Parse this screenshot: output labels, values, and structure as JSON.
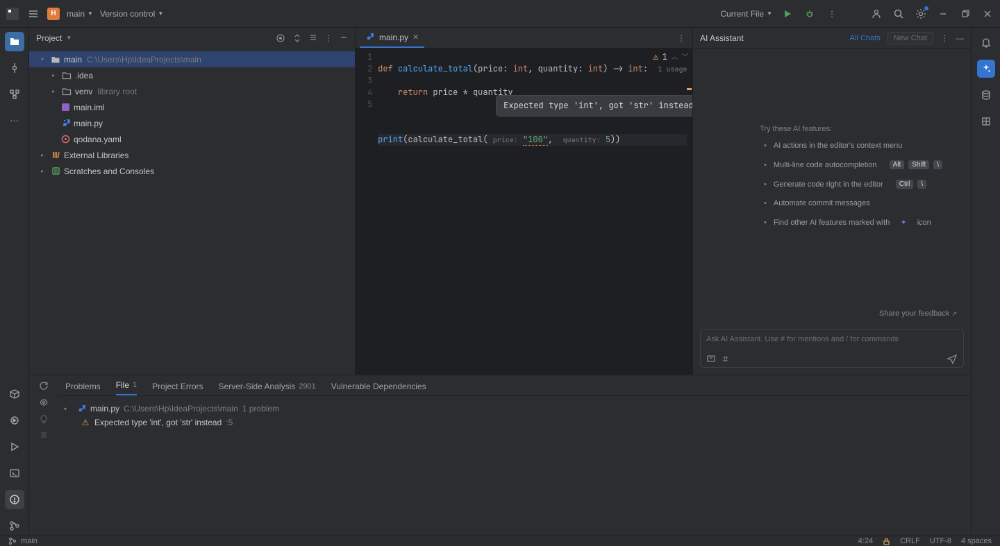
{
  "titlebar": {
    "project_initial": "H",
    "project_name": "main",
    "vcs_label": "Version control",
    "run_config": "Current File"
  },
  "project_panel": {
    "title": "Project",
    "tree": {
      "root_name": "main",
      "root_path": "C:\\Users\\Hp\\IdeaProjects\\main",
      "idea_folder": ".idea",
      "venv_folder": "venv",
      "venv_hint": "library root",
      "main_iml": "main.iml",
      "main_py": "main.py",
      "qodana": "qodana.yaml",
      "external_libs": "External Libraries",
      "scratches": "Scratches and Consoles"
    }
  },
  "editor": {
    "tab_name": "main.py",
    "warning_count": "1",
    "gutter": [
      "1",
      "2",
      "3",
      "4",
      "5"
    ],
    "code": {
      "l1_def": "def",
      "l1_fn": "calculate_total",
      "l1_sig_a": "(price: ",
      "l1_int1": "int",
      "l1_sig_b": ", quantity: ",
      "l1_int2": "int",
      "l1_sig_c": ") -> ",
      "l1_int3": "int",
      "l1_sig_d": ":",
      "l1_usage": "1 usage",
      "l2_ret": "return",
      "l2_expr": " price * quantity",
      "l4_print": "print",
      "l4_open": "(",
      "l4_call": "calculate_total",
      "l4_hp": "price:",
      "l4_arg1": "\"100\"",
      "l4_comma": ",  ",
      "l4_hq": "quantity:",
      "l4_arg2": "5",
      "l4_close": "))"
    },
    "tooltip": "Expected type 'int', got 'str' instead"
  },
  "ai": {
    "title": "AI Assistant",
    "all_chats": "All Chats",
    "new_chat": "New Chat",
    "try_heading": "Try these AI features:",
    "features": [
      "AI actions in the editor's context menu",
      "Multi-line code autocompletion",
      "Generate code right in the editor",
      "Automate commit messages",
      "Find other AI features marked with"
    ],
    "kbd_alt": "Alt",
    "kbd_shift": "Shift",
    "kbd_bslash": "\\",
    "kbd_ctrl": "Ctrl",
    "icon_word": "icon",
    "feedback": "Share your feedback",
    "input_placeholder": "Ask AI Assistant. Use # for mentions and / for commands"
  },
  "problems": {
    "tabs": {
      "problems": "Problems",
      "file": "File",
      "file_cnt": "1",
      "project_errors": "Project Errors",
      "server": "Server-Side Analysis",
      "server_cnt": "2901",
      "vuln": "Vulnerable Dependencies"
    },
    "file_row": {
      "name": "main.py",
      "path": "C:\\Users\\Hp\\IdeaProjects\\main",
      "count": "1 problem"
    },
    "item": {
      "text": "Expected type 'int', got 'str' instead",
      "loc": ":5"
    }
  },
  "status": {
    "branch": "main",
    "caret": "4:24",
    "crlf": "CRLF",
    "enc": "UTF-8",
    "indent": "4 spaces"
  }
}
